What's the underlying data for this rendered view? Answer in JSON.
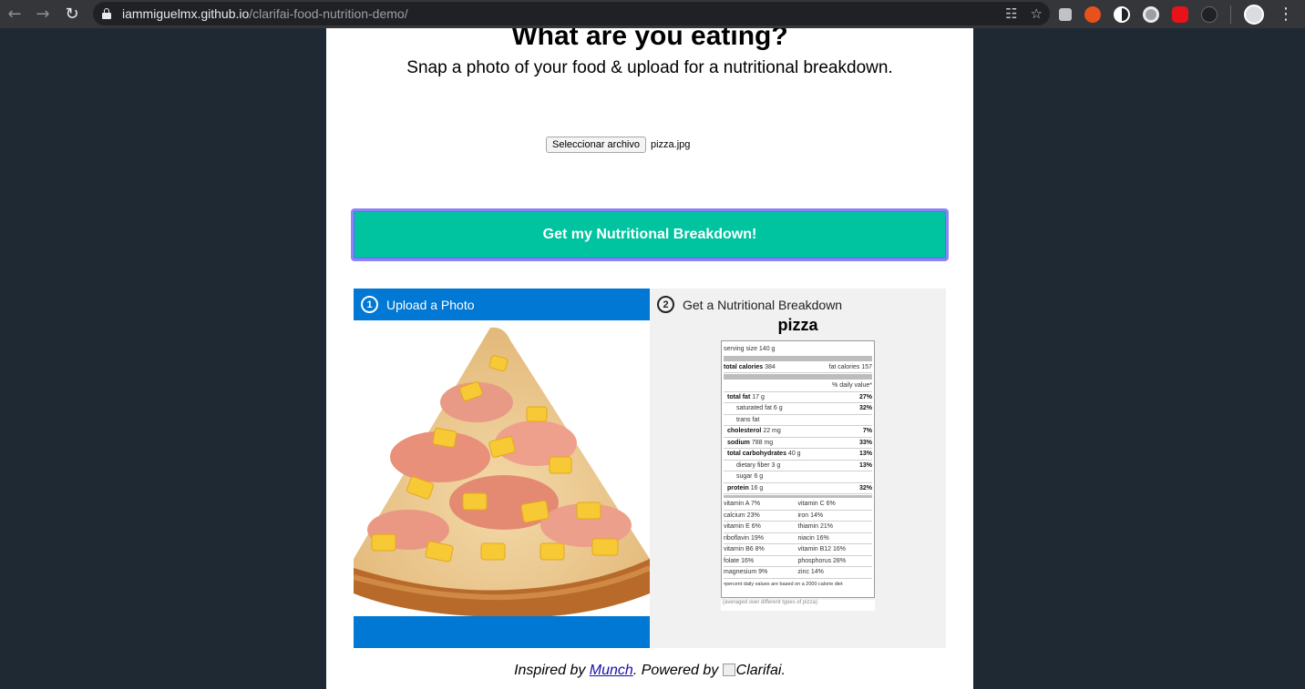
{
  "browser": {
    "url_host": "iammiguelmx.github.io",
    "url_path": "/clarifai-food-nutrition-demo/"
  },
  "page": {
    "title": "What are you eating?",
    "subtitle": "Snap a photo of your food & upload for a nutritional breakdown.",
    "file_button": "Seleccionar archivo",
    "file_name": "pizza.jpg",
    "cta_label": "Get my Nutritional Breakdown!",
    "step1_num": "1",
    "step1_label": "Upload a Photo",
    "step2_num": "2",
    "step2_label": "Get a Nutritional Breakdown",
    "food_name": "pizza"
  },
  "nutrition": {
    "serving_size": "serving size 140 g",
    "total_calories_label": "total calories",
    "total_calories": "384",
    "fat_calories": "fat calories 157",
    "daily_value_header": "% daily value*",
    "rows": [
      {
        "label": "total fat",
        "amount": "17 g",
        "pct": "27%",
        "bold": true
      },
      {
        "label": "saturated fat",
        "amount": "6 g",
        "pct": "32%",
        "bold": false
      },
      {
        "label": "trans fat",
        "amount": "",
        "pct": "",
        "bold": false
      },
      {
        "label": "cholesterol",
        "amount": "22 mg",
        "pct": "7%",
        "bold": true
      },
      {
        "label": "sodium",
        "amount": "788 mg",
        "pct": "33%",
        "bold": true
      },
      {
        "label": "total carbohydrates",
        "amount": "40 g",
        "pct": "13%",
        "bold": true
      },
      {
        "label": "dietary fiber",
        "amount": "3 g",
        "pct": "13%",
        "bold": false
      },
      {
        "label": "sugar",
        "amount": "6 g",
        "pct": "",
        "bold": false
      },
      {
        "label": "protein",
        "amount": "16 g",
        "pct": "32%",
        "bold": true
      }
    ],
    "vitamins": [
      [
        "vitamin A  7%",
        "vitamin C  6%"
      ],
      [
        "calcium  23%",
        "iron  14%"
      ],
      [
        "vitamin E  6%",
        "thiamin  21%"
      ],
      [
        "riboflavin  19%",
        "niacin  16%"
      ],
      [
        "vitamin B6  8%",
        "vitamin B12  16%"
      ],
      [
        "folate  16%",
        "phosphorus  28%"
      ],
      [
        "magnesium  9%",
        "zinc  14%"
      ]
    ],
    "footnote": "•percent daily values are based on a 2000 calorie diet",
    "averaged": "(averaged over different types of pizza)"
  },
  "footer": {
    "prefix": "Inspired by ",
    "link": "Munch",
    "middle": ". Powered by ",
    "img_alt": "Clarifai",
    "suffix": "."
  }
}
